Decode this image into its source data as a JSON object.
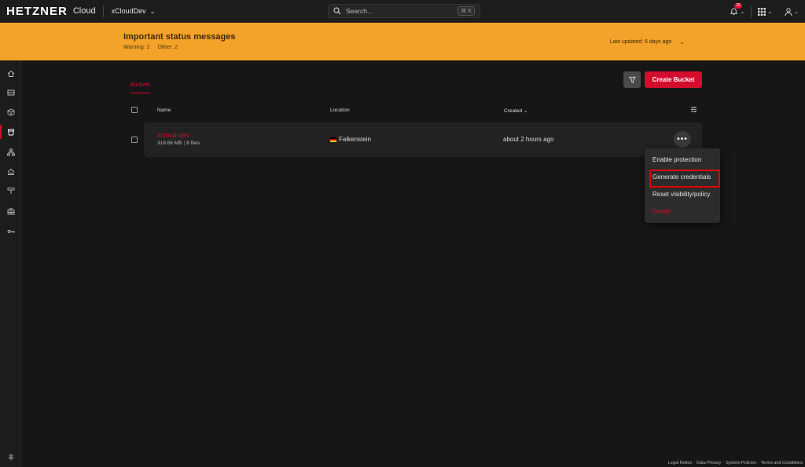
{
  "topbar": {
    "logo": "HETZNER",
    "logo_sub": "Cloud",
    "project": "xCloudDev",
    "search_placeholder": "Search...",
    "search_shortcut": "⌘ K",
    "notification_count": "25"
  },
  "banner": {
    "title": "Important status messages",
    "warning": "Warning: 2",
    "other": "Other: 2",
    "last_updated": "Last updated: 6 days ago"
  },
  "sidebar": {
    "items": [
      "home",
      "servers",
      "volumes",
      "buckets",
      "networks",
      "load-balancers",
      "floating-ips",
      "firewalls",
      "ssh-keys"
    ]
  },
  "main": {
    "tab": "Buckets",
    "create_button": "Create Bucket",
    "columns": {
      "name": "Name",
      "location": "Location",
      "created": "Created"
    },
    "rows": [
      {
        "name": "xcloud-dev",
        "size": "318.66 MB",
        "files": "8 files",
        "location": "Falkenstein",
        "created": "about 2 hours ago"
      }
    ]
  },
  "context_menu": {
    "items": [
      "Enable protection",
      "Generate credentials",
      "Reset visibility/policy",
      "Delete"
    ]
  },
  "footer": {
    "links": [
      "Legal Notice",
      "Data Privacy",
      "System Policies",
      "Terms and Conditions"
    ]
  },
  "colors": {
    "brand_red": "#d50c2d",
    "banner": "#f4a32a",
    "background": "#161616"
  }
}
